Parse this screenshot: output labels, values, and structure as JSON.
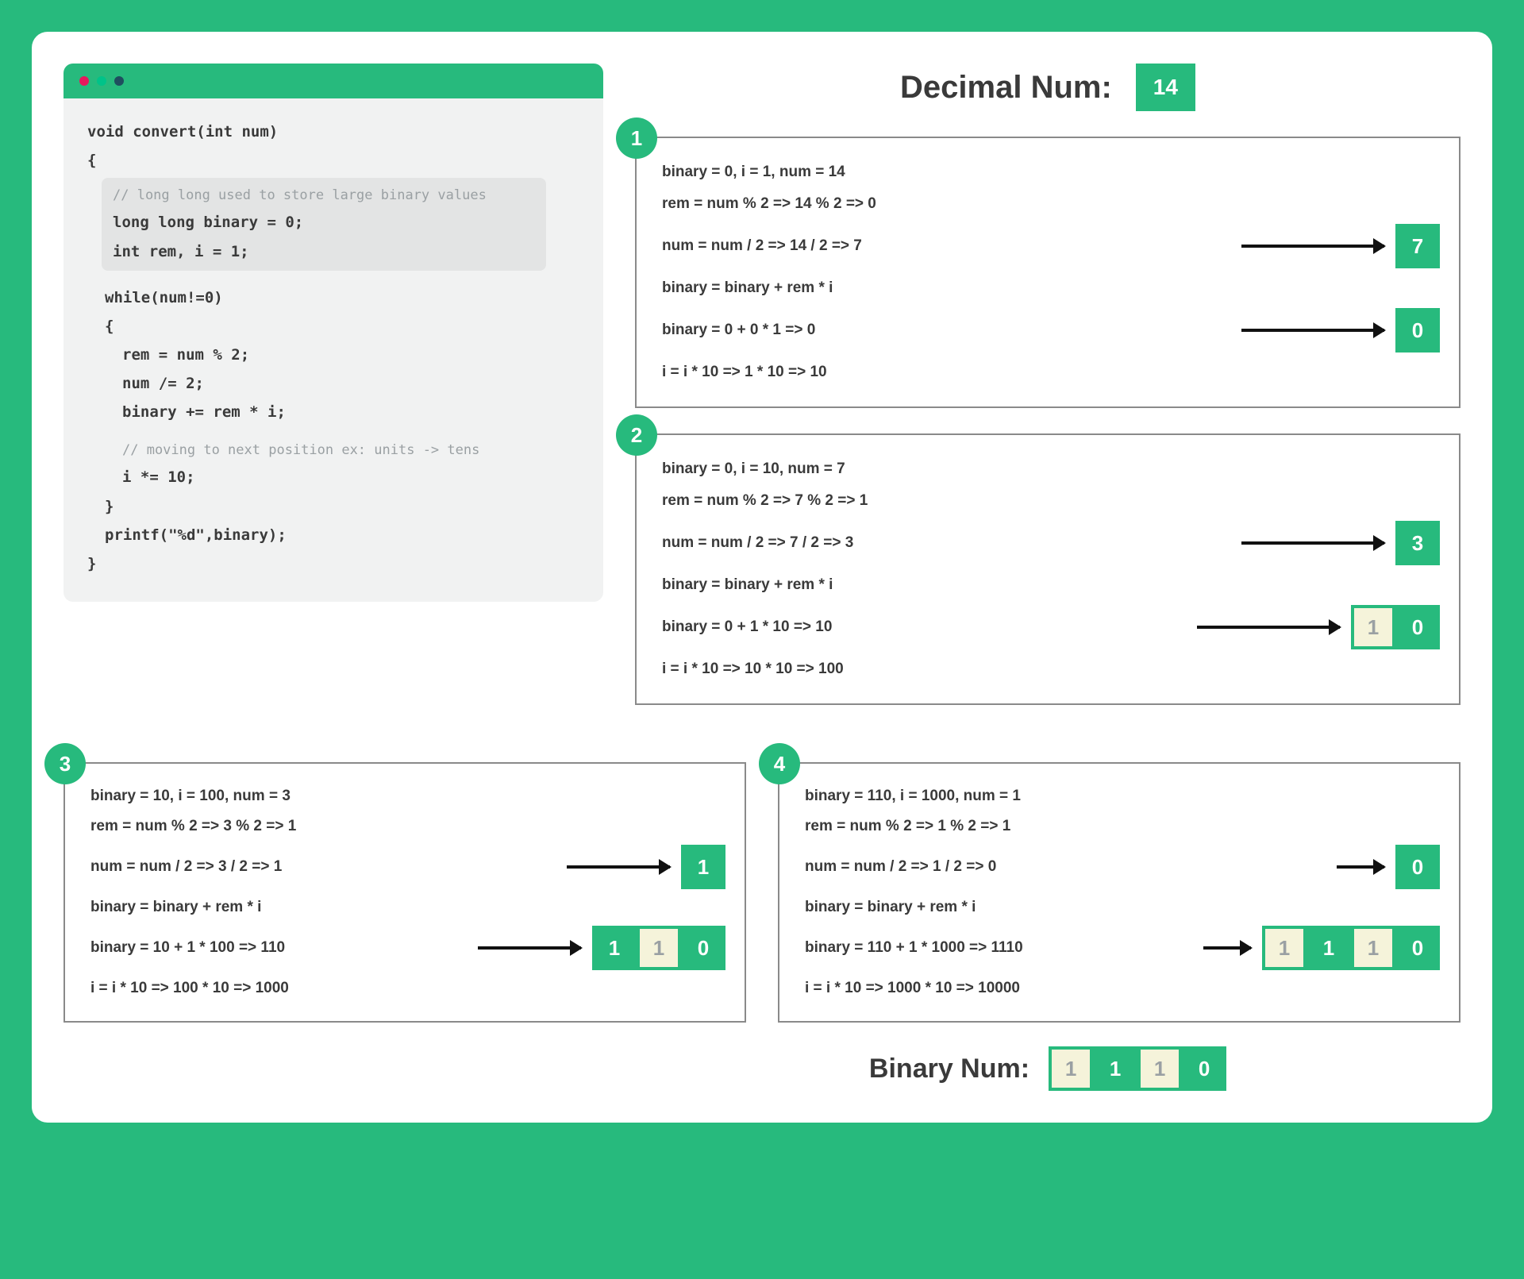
{
  "header": {
    "label": "Decimal Num:",
    "value": "14"
  },
  "code": {
    "sig": "void convert(int num)",
    "lb": "{",
    "comment1": "// long long used to store large binary values",
    "l1": "long long binary = 0;",
    "l2": "int rem, i = 1;",
    "l3": "while(num!=0)",
    "l4": "{",
    "l5": "rem = num % 2;",
    "l6": "num /= 2;",
    "l7": "binary += rem * i;",
    "comment2": "// moving to next position ex: units -> tens",
    "l8": "i *= 10;",
    "l9": "}",
    "l10": "printf(\"%d\",binary);",
    "rb": "}"
  },
  "steps": [
    {
      "n": "1",
      "line1": "binary = 0, i = 1, num = 14",
      "line2": "rem = num % 2 => 14 % 2 => 0",
      "line3": "num = num / 2 => 14 / 2 => 7",
      "numCells": [
        {
          "v": "7",
          "c": "green"
        }
      ],
      "line4a": "binary = binary + rem * i",
      "line4b": "binary = 0 + 0 * 1 => 0",
      "binCells": [
        {
          "v": "0",
          "c": "green"
        }
      ],
      "line5": "i = i * 10 => 1 * 10 => 10"
    },
    {
      "n": "2",
      "line1": "binary = 0, i = 10, num = 7",
      "line2": "rem = num % 2 => 7 % 2 => 1",
      "line3": "num = num / 2 => 7 / 2 => 3",
      "numCells": [
        {
          "v": "3",
          "c": "green"
        }
      ],
      "line4a": "binary = binary + rem * i",
      "line4b": "binary = 0 + 1 * 10 => 10",
      "binCells": [
        {
          "v": "1",
          "c": "cream"
        },
        {
          "v": "0",
          "c": "green"
        }
      ],
      "line5": "i = i * 10 => 10 * 10 => 100"
    },
    {
      "n": "3",
      "line1": "binary = 10, i = 100, num = 3",
      "line2": "rem = num % 2 => 3 % 2 => 1",
      "line3": "num = num / 2 => 3 / 2 => 1",
      "numCells": [
        {
          "v": "1",
          "c": "green"
        }
      ],
      "line4a": "binary = binary + rem * i",
      "line4b": "binary = 10 + 1 * 100 => 110",
      "binCells": [
        {
          "v": "1",
          "c": "green"
        },
        {
          "v": "1",
          "c": "cream"
        },
        {
          "v": "0",
          "c": "green"
        }
      ],
      "line5": "i = i * 10 => 100 * 10 => 1000"
    },
    {
      "n": "4",
      "line1": "binary = 110, i = 1000, num = 1",
      "line2": "rem = num % 2 => 1 % 2 => 1",
      "line3": "num = num / 2 => 1 / 2 => 0",
      "numCells": [
        {
          "v": "0",
          "c": "green"
        }
      ],
      "line4a": "binary = binary + rem * i",
      "line4b": "binary = 110 + 1 * 1000 => 1110",
      "binCells": [
        {
          "v": "1",
          "c": "cream"
        },
        {
          "v": "1",
          "c": "green"
        },
        {
          "v": "1",
          "c": "cream"
        },
        {
          "v": "0",
          "c": "green"
        }
      ],
      "line5": "i = i * 10 => 1000 * 10 => 10000"
    }
  ],
  "final": {
    "label": "Binary Num:",
    "cells": [
      {
        "v": "1",
        "c": "cream"
      },
      {
        "v": "1",
        "c": "green"
      },
      {
        "v": "1",
        "c": "cream"
      },
      {
        "v": "0",
        "c": "green"
      }
    ]
  }
}
